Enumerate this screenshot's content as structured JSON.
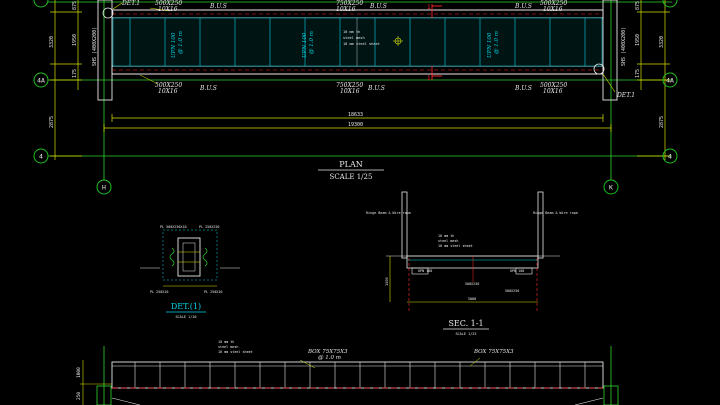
{
  "colors": {
    "background": "#000000",
    "dimension_line": "#d7e000",
    "grid_line": "#2fd62f",
    "structure": "#e8e8e8",
    "annotation": "#00d8e8",
    "label_white": "#ffffff",
    "accent_red": "#ff2a2a",
    "grid_bubble": "#20c020"
  },
  "plan": {
    "top_beam_left": "500X250",
    "top_beam_left_sub": "10X16",
    "top_beam_mid": "750X250",
    "top_beam_mid_sub": "10X16",
    "top_beam_right": "500X250",
    "top_beam_right_sub": "10X16",
    "bus_label": "B.U.S",
    "bot_beam_left": "500X250",
    "bot_beam_left_sub": "10X16",
    "bot_beam_mid": "750X250",
    "bot_beam_mid_sub": "10X16",
    "bot_beam_right": "500X250",
    "bot_beam_right_sub": "10X16",
    "upn_left": "UPN 100",
    "upn_left_sub": "@ 1.0 m",
    "upn_right": "UPN 100",
    "upn_right_sub": "@ 1.0 m",
    "upn_mid": "UPN 100",
    "upn_mid_sub": "@ 1.0 m",
    "deck_note_1": "10 mm th",
    "deck_note_2": "steel mesh",
    "deck_note_3": "10 mm steel sheet",
    "det_top": "DET.1",
    "det_bottom": "DET.1",
    "left_col_1": "SHS (400X200)",
    "right_col_1": "SHS (400X200)",
    "left_dim_top": "875",
    "left_dim_mid": "1950",
    "left_dim_total": "3320",
    "left_dim_small": "175",
    "left_dim_low": "2875",
    "right_dim_top": "875",
    "right_dim_mid": "1950",
    "right_dim_total": "3320",
    "right_dim_small": "175",
    "right_dim_low": "2875",
    "span_inner": "18633",
    "span_total": "19300",
    "title": "PLAN",
    "scale": "SCALE 1/25",
    "section_mark_top": "1",
    "section_mark_bottom": "1"
  },
  "grid": {
    "row_4a": "4A",
    "row_4": "4",
    "col_h": "H",
    "col_k": "K"
  },
  "detail": {
    "title": "DET.(1)",
    "scale": "SCALE 1/10",
    "note_top_left": "PL 500X250X10",
    "note_top_right": "PL 250X250",
    "note_bottom_left": "PL 250X10",
    "note_bottom_right": "PL 250X10"
  },
  "section": {
    "title": "SEC. 1-1",
    "scale": "SCALE 1/25",
    "note_left": "Hinge Beam & Wire rope",
    "note_right": "Hinge Beam & Wire rope",
    "deck_note_1": "10 mm th",
    "deck_note_2": "steel mesh",
    "deck_note_3": "10 mm steel sheet",
    "ibeam_left": "UPN 100",
    "ibeam_right": "UPN 100",
    "bottom_left": "500X250",
    "bottom_right": "500X250",
    "width_dim": "3000",
    "height_dim": "1500"
  },
  "elevation": {
    "box_left": "BOX 75X75X3",
    "box_left_sub": "@ 1.0 m",
    "box_right": "BOX 75X75X3",
    "note_1": "10 mm th",
    "note_2": "steel mesh",
    "note_3": "10 mm steel sheet",
    "dim_a": "1000",
    "dim_b": "250"
  }
}
